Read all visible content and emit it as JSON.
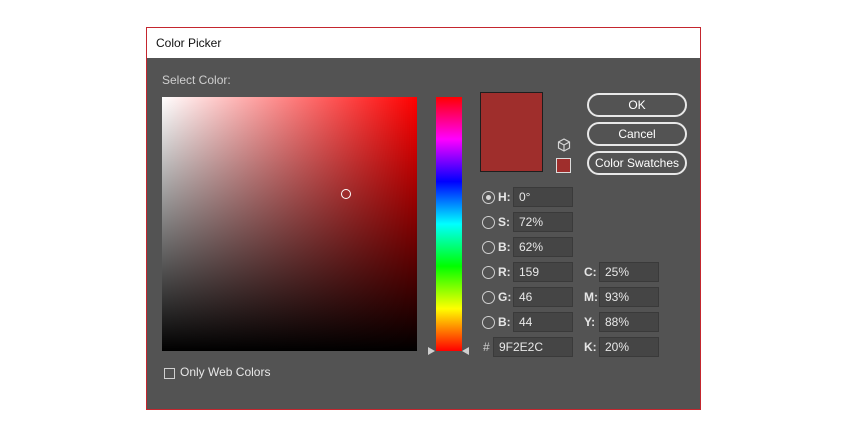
{
  "dialog": {
    "title": "Color Picker",
    "select_color_label": "Select Color:",
    "current_color": "#9f2e2c",
    "marker": {
      "saturation": 0.72,
      "brightness": 0.62
    },
    "hue_position": 0.0
  },
  "buttons": {
    "ok": "OK",
    "cancel": "Cancel",
    "color_swatches": "Color Swatches"
  },
  "hsb": [
    {
      "label": "H:",
      "value": "0°",
      "checked": true
    },
    {
      "label": "S:",
      "value": "72%",
      "checked": false
    },
    {
      "label": "B:",
      "value": "62%",
      "checked": false
    }
  ],
  "rgb": [
    {
      "label": "R:",
      "value": "159",
      "checked": false
    },
    {
      "label": "G:",
      "value": "46",
      "checked": false
    },
    {
      "label": "B:",
      "value": "44",
      "checked": false
    }
  ],
  "cmyk": [
    {
      "label": "C:",
      "value": "25%"
    },
    {
      "label": "M:",
      "value": "93%"
    },
    {
      "label": "Y:",
      "value": "88%"
    },
    {
      "label": "K:",
      "value": "20%"
    }
  ],
  "hex": {
    "symbol": "#",
    "value": "9F2E2C"
  },
  "web_colors": {
    "label": "Only Web Colors",
    "checked": false
  },
  "icons": {
    "gamut": "cube-icon"
  }
}
